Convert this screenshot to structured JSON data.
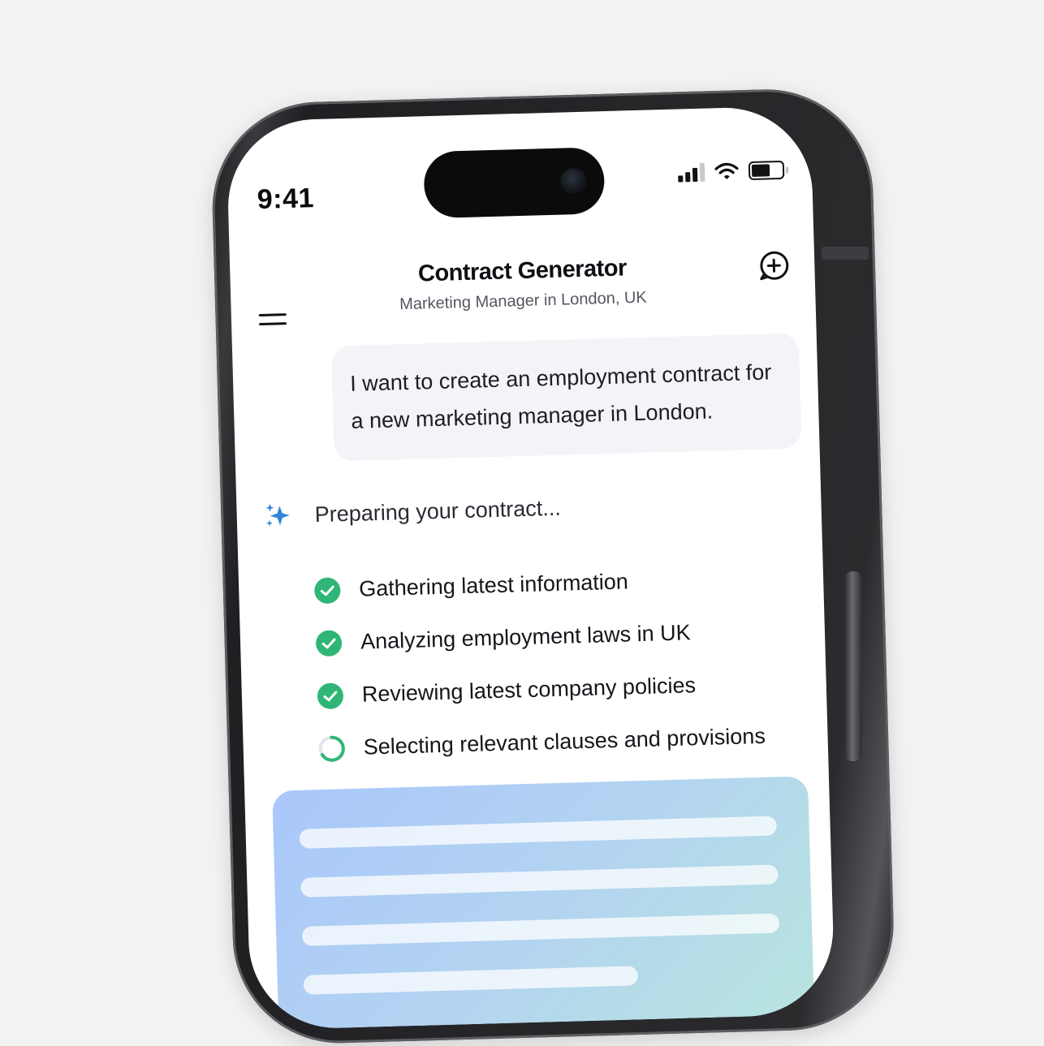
{
  "status_bar": {
    "time": "9:41"
  },
  "header": {
    "title": "Contract Generator",
    "subtitle": "Marketing Manager in London, UK"
  },
  "chat": {
    "user_message_lines": [
      "I want to create an employment contract for",
      "a new marketing manager in London."
    ],
    "assistant_status": "Preparing your contract..."
  },
  "steps": [
    {
      "label": "Gathering latest information",
      "state": "done"
    },
    {
      "label": "Analyzing employment laws in UK",
      "state": "done"
    },
    {
      "label": "Reviewing latest company policies",
      "state": "done"
    },
    {
      "label": "Selecting relevant clauses and provisions",
      "state": "in-progress"
    }
  ],
  "colors": {
    "accent_green": "#2fb676",
    "sparkle_blue": "#2f86d9",
    "card_gradient_start": "#a9c7fb",
    "card_gradient_end": "#b8e6dd"
  },
  "icons": {
    "menu": "hamburger-icon",
    "new_chat": "chat-plus-icon",
    "assistant": "sparkle-icon",
    "done": "check-circle-icon",
    "in_progress": "spinner-icon"
  }
}
